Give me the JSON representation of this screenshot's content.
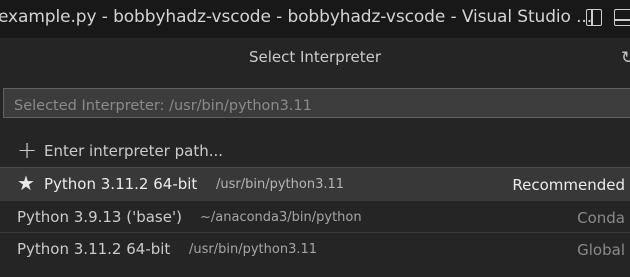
{
  "window": {
    "title": "example.py - bobbyhadz-vscode - bobbyhadz-vscode - Visual Studio ..."
  },
  "picker": {
    "title": "Select Interpreter",
    "placeholder": "Selected Interpreter: /usr/bin/python3.11",
    "items": [
      {
        "icon": "plus-icon",
        "label": "Enter interpreter path...",
        "description": "",
        "tag": ""
      },
      {
        "icon": "star-icon",
        "label": "Python 3.11.2 64-bit",
        "description": "/usr/bin/python3.11",
        "tag": "Recommended"
      },
      {
        "icon": "",
        "label": "Python 3.9.13 ('base')",
        "description": "~/anaconda3/bin/python",
        "tag": "Conda"
      },
      {
        "icon": "",
        "label": "Python 3.11.2 64-bit",
        "description": "/usr/bin/python3.11",
        "tag": "Global"
      }
    ]
  }
}
